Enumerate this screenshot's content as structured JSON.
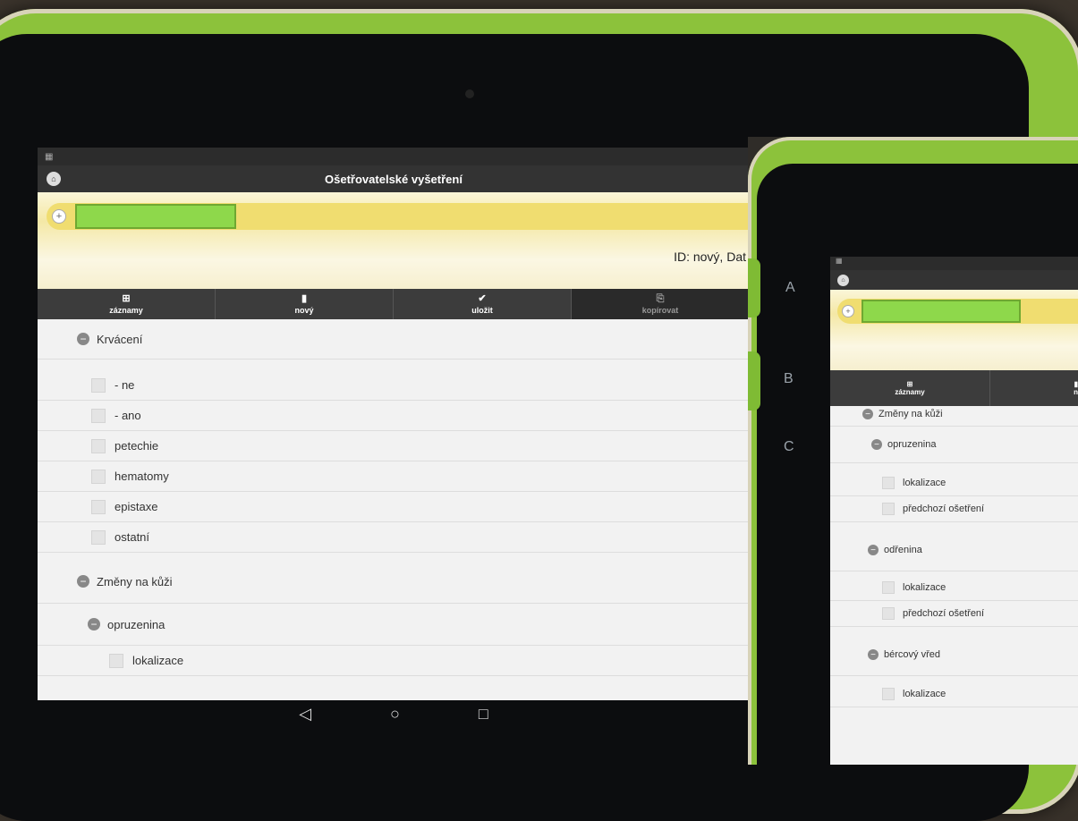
{
  "header": {
    "title": "Ošetřovatelské vyšetření",
    "record_id": "ID: nový, Dat"
  },
  "toolbar": {
    "items": [
      {
        "label": "záznamy",
        "icon": "list-icon"
      },
      {
        "label": "nový",
        "icon": "new-document-icon"
      },
      {
        "label": "uložit",
        "icon": "check-icon"
      },
      {
        "label": "kopírovat",
        "icon": "copy-icon"
      }
    ]
  },
  "main_list": {
    "section_bleeding": {
      "label": "Krvácení",
      "options": [
        "- ne",
        "- ano",
        "petechie",
        "hematomy",
        "epistaxe",
        "ostatní"
      ]
    },
    "section_skin": {
      "label": "Změny na kůži",
      "sub_section": {
        "label": "opruzenina",
        "options": [
          "lokalizace"
        ]
      }
    }
  },
  "inset": {
    "side_labels": [
      "A",
      "B",
      "C"
    ],
    "toolbar_label": "záznamy",
    "toolbar_partial": "n",
    "section_label": "Změny na kůži",
    "groups": [
      {
        "label": "opruzenina",
        "options": [
          "lokalizace",
          "předchozí ošetření"
        ]
      },
      {
        "label": "odřenina",
        "options": [
          "lokalizace",
          "předchozí ošetření"
        ]
      },
      {
        "label": "bércový vřed",
        "options": [
          "lokalizace"
        ]
      }
    ]
  },
  "navbar": {
    "back": "◁",
    "home": "○",
    "recents": "□"
  }
}
